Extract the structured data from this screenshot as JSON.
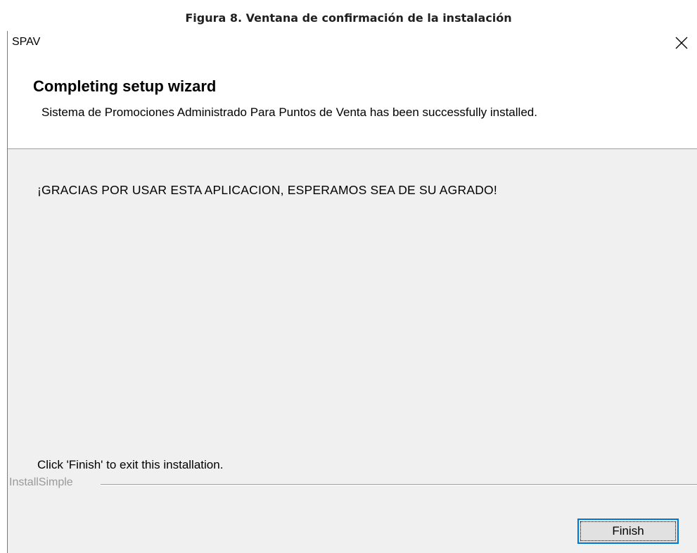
{
  "caption": "Figura 8. Ventana de confirmación de la instalación",
  "window": {
    "title": "SPAV",
    "close_icon": "close-icon"
  },
  "header": {
    "title": "Completing setup wizard",
    "subtitle": "Sistema de Promociones Administrado Para Puntos de Venta has been successfully installed."
  },
  "body": {
    "message": "¡GRACIAS POR USAR ESTA APLICACION, ESPERAMOS SEA DE SU AGRADO!",
    "finish_hint": "Click 'Finish' to exit this installation."
  },
  "footer": {
    "brand": "InstallSimple",
    "finish_label": "Finish"
  },
  "colors": {
    "accent": "#0078d7",
    "dialog_background": "#f0f0f0",
    "brand_text": "#9a9a9a"
  }
}
